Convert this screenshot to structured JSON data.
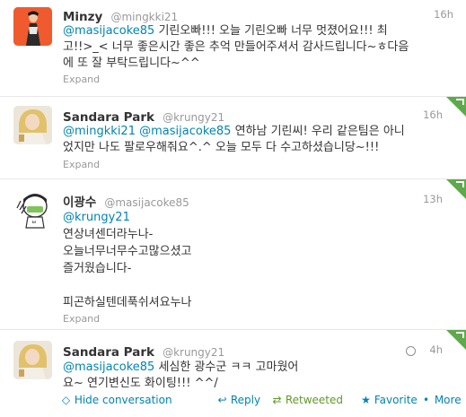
{
  "tweets": [
    {
      "fullname": "Minzy",
      "username": "@mingkki21",
      "time": "16h",
      "mention": "@masijacoke85",
      "line1": " 기린오빠!!! 오늘 기린오빠 너무 멋졌어요!!! 최",
      "line2": "고!!>_< 너무 좋은시간 좋은 추억 만들어주셔서 감사드립니다~ㅎ다음",
      "line3": "에 또 잘 부탁드립니다~^^",
      "expand": "Expand"
    },
    {
      "fullname": "Sandara Park",
      "username": "@krungy21",
      "time": "16h",
      "mention1": "@mingkki21",
      "mention2": "@masijacoke85",
      "line1": " 연하남 기린씨! 우리 같은팀은 아니",
      "line2": "었지만 나도 팔로우해줘요^.^ 오늘 모두 다 수고하셨습니당~!!!",
      "expand": "Expand"
    },
    {
      "fullname": "이광수",
      "username": "@masijacoke85",
      "time": "13h",
      "mention": "@krungy21",
      "line1": "연상녀센더라누나-",
      "line2": "오늘너무너무수고많으셨고",
      "line3": "즐거웠습니다-",
      "line4": "피곤하실텐데푹쉬셔요누나",
      "expand": "Expand"
    },
    {
      "fullname": "Sandara Park",
      "username": "@krungy21",
      "time": "4h",
      "mention": "@masijacoke85",
      "line1": " 세심한 광수군 ㅋㅋ 고마웠어",
      "line2": "요~ 연기변신도 화이팅!!! ^^/",
      "hide": "Hide conversation",
      "reply": "Reply",
      "retweeted": "Retweeted",
      "favorite": "Favorite",
      "more": "More"
    }
  ],
  "colors": {
    "link": "#0084b4",
    "retweeted": "#609928",
    "corner": "#5ea94b"
  }
}
